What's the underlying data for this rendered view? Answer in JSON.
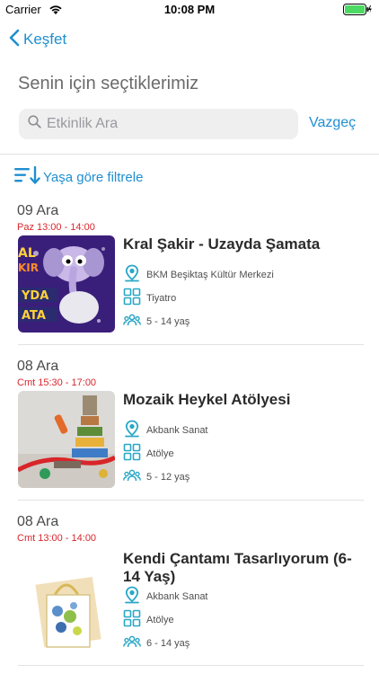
{
  "status_bar": {
    "carrier": "Carrier",
    "time": "10:08 PM"
  },
  "nav": {
    "back_label": "Keşfet"
  },
  "page_title": "Senin için seçtiklerimiz",
  "search": {
    "placeholder": "Etkinlik Ara",
    "cancel_label": "Vazgeç"
  },
  "filter": {
    "label": "Yaşa göre filtrele"
  },
  "colors": {
    "accent": "#1f8fd0",
    "time_red": "#d9262c",
    "icon_teal": "#2aa7c6"
  },
  "events": [
    {
      "date": "09 Ara",
      "time": "Paz 13:00 - 14:00",
      "title": "Kral Şakir - Uzayda Şamata",
      "venue": "BKM Beşiktaş Kültür Merkezi",
      "category": "Tiyatro",
      "age": "5 - 14 yaş"
    },
    {
      "date": "08 Ara",
      "time": "Cmt 15:30 - 17:00",
      "title": "Mozaik Heykel Atölyesi",
      "venue": "Akbank Sanat",
      "category": "Atölye",
      "age": "5 - 12 yaş"
    },
    {
      "date": "08 Ara",
      "time": "Cmt 13:00 - 14:00",
      "title": "Kendi Çantamı Tasarlıyorum (6-14 Yaş)",
      "venue": "Akbank Sanat",
      "category": "Atölye",
      "age": "6 - 14 yaş"
    }
  ]
}
